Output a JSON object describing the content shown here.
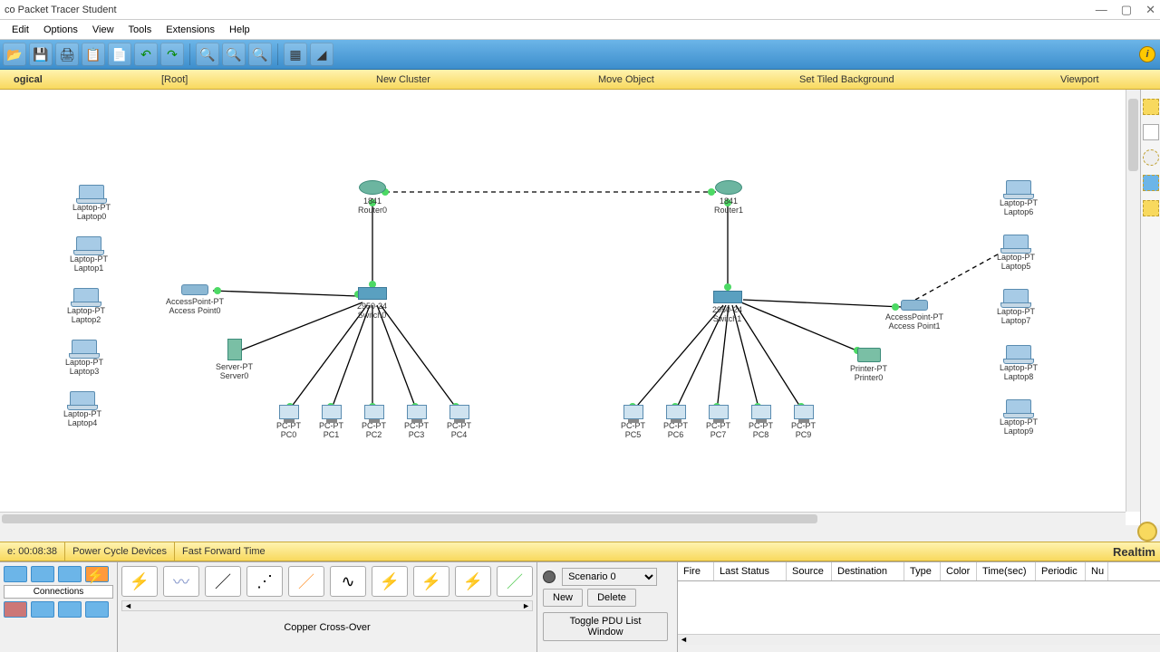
{
  "app": {
    "title": "co Packet Tracer Student"
  },
  "menu": {
    "items": [
      "Edit",
      "Options",
      "View",
      "Tools",
      "Extensions",
      "Help"
    ]
  },
  "tabs": {
    "logical": "ogical",
    "root": "[Root]",
    "newcluster": "New Cluster",
    "moveobj": "Move Object",
    "setbg": "Set Tiled Background",
    "viewport": "Viewport"
  },
  "status": {
    "time": "e: 00:08:38",
    "pcd": "Power Cycle Devices",
    "fft": "Fast Forward Time",
    "realtime": "Realtim"
  },
  "devpal": {
    "label": "Connections",
    "tooltip": "Copper Cross-Over"
  },
  "scenario": {
    "selected": "Scenario 0",
    "new": "New",
    "delete": "Delete",
    "toggle": "Toggle PDU List Window"
  },
  "pdu": {
    "cols": [
      "Fire",
      "Last Status",
      "Source",
      "Destination",
      "Type",
      "Color",
      "Time(sec)",
      "Periodic",
      "Nu"
    ]
  },
  "nodes": {
    "router0": {
      "m": "1841",
      "n": "Router0"
    },
    "router1": {
      "m": "1841",
      "n": "Router1"
    },
    "switch0": {
      "m": "2950-24",
      "n": "Switch0"
    },
    "switch1": {
      "m": "2950-24",
      "n": "Switch1"
    },
    "ap0": {
      "m": "AccessPoint-PT",
      "n": "Access Point0"
    },
    "ap1": {
      "m": "AccessPoint-PT",
      "n": "Access Point1"
    },
    "server0": {
      "m": "Server-PT",
      "n": "Server0"
    },
    "printer0": {
      "m": "Printer-PT",
      "n": "Printer0"
    },
    "pc0": {
      "m": "PC-PT",
      "n": "PC0"
    },
    "pc1": {
      "m": "PC-PT",
      "n": "PC1"
    },
    "pc2": {
      "m": "PC-PT",
      "n": "PC2"
    },
    "pc3": {
      "m": "PC-PT",
      "n": "PC3"
    },
    "pc4": {
      "m": "PC-PT",
      "n": "PC4"
    },
    "pc5": {
      "m": "PC-PT",
      "n": "PC5"
    },
    "pc6": {
      "m": "PC-PT",
      "n": "PC6"
    },
    "pc7": {
      "m": "PC-PT",
      "n": "PC7"
    },
    "pc8": {
      "m": "PC-PT",
      "n": "PC8"
    },
    "pc9": {
      "m": "PC-PT",
      "n": "PC9"
    },
    "lt0": {
      "m": "Laptop-PT",
      "n": "Laptop0"
    },
    "lt1": {
      "m": "Laptop-PT",
      "n": "Laptop1"
    },
    "lt2": {
      "m": "Laptop-PT",
      "n": "Laptop2"
    },
    "lt3": {
      "m": "Laptop-PT",
      "n": "Laptop3"
    },
    "lt4": {
      "m": "Laptop-PT",
      "n": "Laptop4"
    },
    "lt5": {
      "m": "Laptop-PT",
      "n": "Laptop5"
    },
    "lt6": {
      "m": "Laptop-PT",
      "n": "Laptop6"
    },
    "lt7": {
      "m": "Laptop-PT",
      "n": "Laptop7"
    },
    "lt8": {
      "m": "Laptop-PT",
      "n": "Laptop8"
    },
    "lt9": {
      "m": "Laptop-PT",
      "n": "Laptop9"
    }
  },
  "colors": {
    "accent": "#f8d95e",
    "link": "#3d8ecc"
  }
}
